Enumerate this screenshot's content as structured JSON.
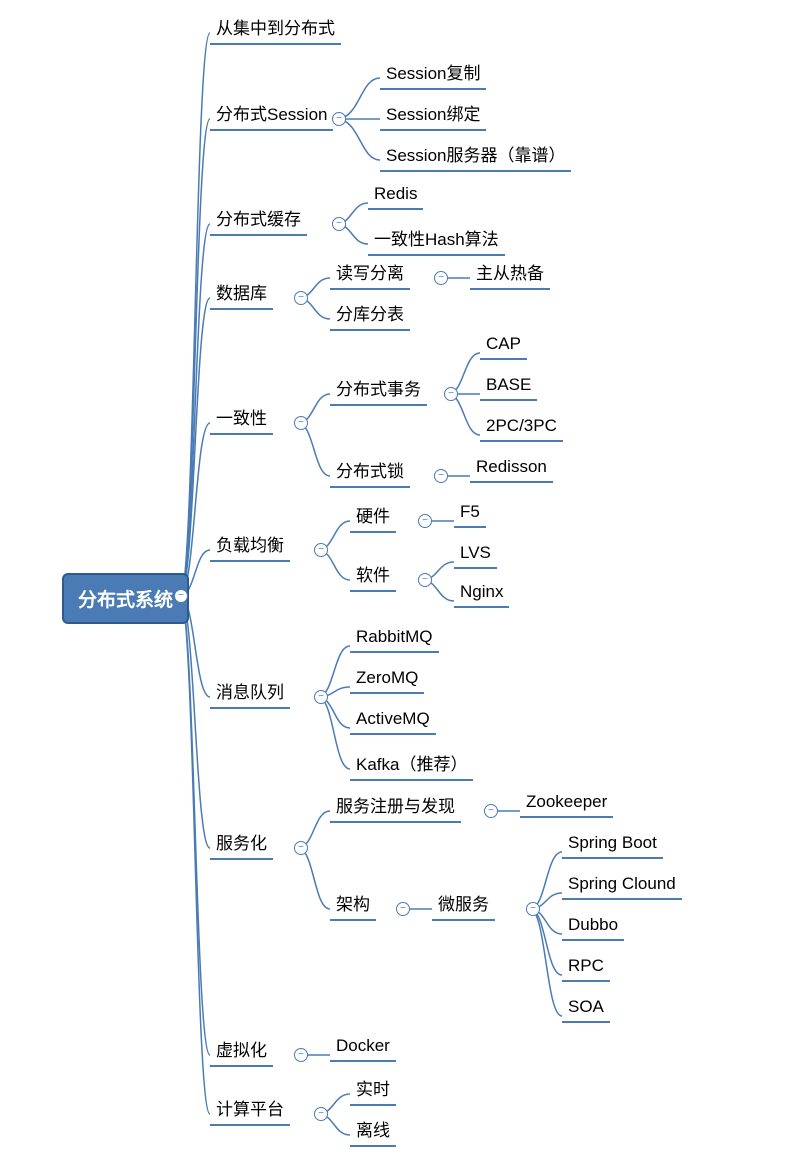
{
  "root": {
    "label": "分布式系统"
  },
  "nodes": {
    "n1": "从集中到分布式",
    "n2": "分布式Session",
    "n2a": "Session复制",
    "n2b": "Session绑定",
    "n2c": "Session服务器（靠谱）",
    "n3": "分布式缓存",
    "n3a": "Redis",
    "n3b": "一致性Hash算法",
    "n4": "数据库",
    "n4a": "读写分离",
    "n4a1": "主从热备",
    "n4b": "分库分表",
    "n5": "一致性",
    "n5a": "分布式事务",
    "n5a1": "CAP",
    "n5a2": "BASE",
    "n5a3": "2PC/3PC",
    "n5b": "分布式锁",
    "n5b1": "Redisson",
    "n6": "负载均衡",
    "n6a": "硬件",
    "n6a1": "F5",
    "n6b": "软件",
    "n6b1": "LVS",
    "n6b2": "Nginx",
    "n7": "消息队列",
    "n7a": "RabbitMQ",
    "n7b": "ZeroMQ",
    "n7c": "ActiveMQ",
    "n7d": "Kafka（推荐）",
    "n8": "服务化",
    "n8a": "服务注册与发现",
    "n8a1": "Zookeeper",
    "n8b": "架构",
    "n8b1": "微服务",
    "n8b1a": "Spring Boot",
    "n8b1b": "Spring Clound",
    "n8b1c": "Dubbo",
    "n8b1d": "RPC",
    "n8b1e": "SOA",
    "n9": "虚拟化",
    "n9a": "Docker",
    "n10": "计算平台",
    "n10a": "实时",
    "n10b": "离线"
  }
}
